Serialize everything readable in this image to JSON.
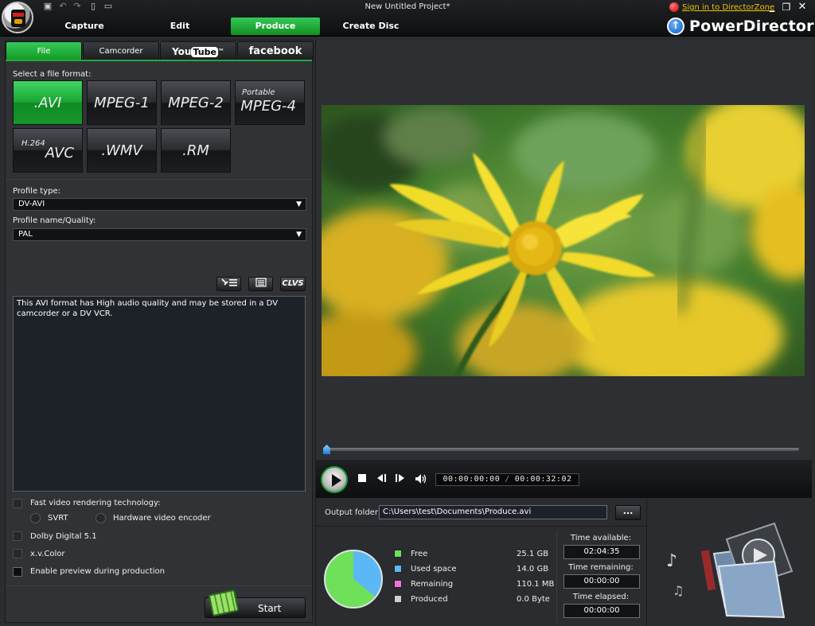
{
  "window": {
    "title": "New Untitled Project*",
    "signin_label": "Sign in to DirectorZone",
    "minimize_glyph": "_",
    "restore_glyph": "❐",
    "close_glyph": "✕"
  },
  "quick_access": [
    {
      "icon": "save-icon",
      "glyph": "▣"
    },
    {
      "icon": "undo-icon",
      "glyph": "↶"
    },
    {
      "icon": "redo-icon",
      "glyph": "↷"
    },
    {
      "icon": "new-project-icon",
      "glyph": "▯"
    },
    {
      "icon": "open-project-icon",
      "glyph": "▭"
    }
  ],
  "nav": {
    "tabs": [
      "Capture",
      "Edit",
      "Produce",
      "Create Disc"
    ],
    "active": "Produce"
  },
  "brand": {
    "name": "PowerDirector",
    "icon_glyph": "↑"
  },
  "produce_tabs": {
    "file": "File",
    "camcorder": "Camcorder",
    "youtube_a": "You",
    "youtube_b": "Tube",
    "youtube_tm": "™",
    "facebook": "facebook",
    "active": "File"
  },
  "format_section": {
    "label": "Select a file format:",
    "formats": [
      {
        "prefix": "",
        "name": ".AVI",
        "active": true
      },
      {
        "prefix": "",
        "name": "MPEG-1"
      },
      {
        "prefix": "",
        "name": "MPEG-2"
      },
      {
        "prefix": "Portable",
        "name": "MPEG-4"
      },
      {
        "prefix": "H.264",
        "name": "AVC"
      },
      {
        "prefix": "",
        "name": ".WMV"
      },
      {
        "prefix": "",
        "name": ".RM"
      }
    ]
  },
  "profile": {
    "type_label": "Profile type:",
    "type_value": "DV-AVI",
    "name_label": "Profile name/Quality:",
    "name_value": "PAL",
    "caret": "▼"
  },
  "toolbar": {
    "clvs_label": "CLVS"
  },
  "description": "This AVI format has High audio quality and may be stored in a DV camcorder or a DV VCR.",
  "options": {
    "fast_render": "Fast video rendering technology:",
    "svrt": "SVRT",
    "hw_encoder": "Hardware video encoder",
    "dolby": "Dolby Digital 5.1",
    "xvcolor": "x.v.Color",
    "preview": "Enable preview during production"
  },
  "start_label": "Start",
  "player": {
    "timecode_current": "00:00:00:00",
    "timecode_separator": "/",
    "timecode_total": "00:00:32:02",
    "progress": 0
  },
  "output": {
    "label": "Output folder:",
    "path": "C:\\Users\\test\\Documents\\Produce.avi",
    "browse_label": "..."
  },
  "disk": {
    "legend": [
      {
        "label": "Free",
        "value": "25.1",
        "unit": "GB",
        "color": "#6fe05a"
      },
      {
        "label": "Used space",
        "value": "14.0",
        "unit": "GB",
        "color": "#5cb8f5"
      },
      {
        "label": "Remaining",
        "value": "110.1",
        "unit": "MB",
        "color": "#f070e0"
      },
      {
        "label": "Produced",
        "value": "0.0",
        "unit": "Byte",
        "color": "#cfcfcf"
      }
    ],
    "free_gb": 25.1,
    "used_gb": 14.0
  },
  "times": {
    "available_label": "Time available:",
    "available_value": "02:04:35",
    "remaining_label": "Time remaining:",
    "remaining_value": "00:00:00",
    "elapsed_label": "Time elapsed:",
    "elapsed_value": "00:00:00"
  },
  "colors": {
    "accent": "#1fa83a",
    "link": "#f3c400",
    "brand_blue": "#0a57c2"
  }
}
